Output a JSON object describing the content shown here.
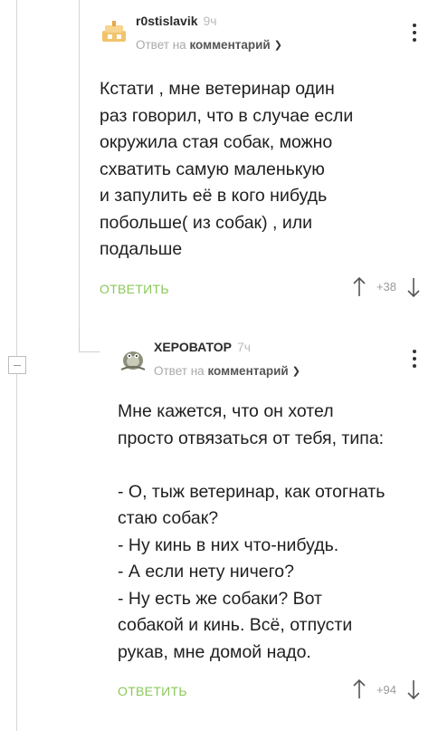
{
  "comments": [
    {
      "author": "r0stislavik",
      "time": "9ч",
      "reply_prefix": "Ответ на",
      "reply_link": "комментарий",
      "text": "Кстати , мне ветеринар один\nраз говорил, что в случае если\nокружила стая собак, можно\nсхватить самую маленькую\nи запулить её в кого нибудь\nпобольше( из собак) , или\nподальше",
      "reply_button": "ОТВЕТИТЬ",
      "rating": "+38"
    },
    {
      "author": "ХЕРОВАТОР",
      "time": "7ч",
      "reply_prefix": "Ответ на",
      "reply_link": "комментарий",
      "text": "Мне кажется, что он хотел\nпросто отвязаться от тебя, типа:\n\n- О, тыж ветеринар, как отогнать\nстаю собак?\n- Ну кинь в них что-нибудь.\n- А если нету ничего?\n- Ну есть же собаки? Вот\nсобакой и кинь. Всё, отпусти\nрукав, мне домой надо.",
      "reply_button": "ОТВЕТИТЬ",
      "rating": "+94"
    }
  ],
  "icons": {
    "more": "kebab-icon",
    "upvote": "arrow-up-icon",
    "downvote": "arrow-down-icon",
    "collapse": "minus-icon",
    "dropdown": "chevron-down-icon"
  },
  "colors": {
    "accent_green": "#8ac858",
    "muted": "#a9a9a9",
    "guide": "#d6d6d6"
  }
}
